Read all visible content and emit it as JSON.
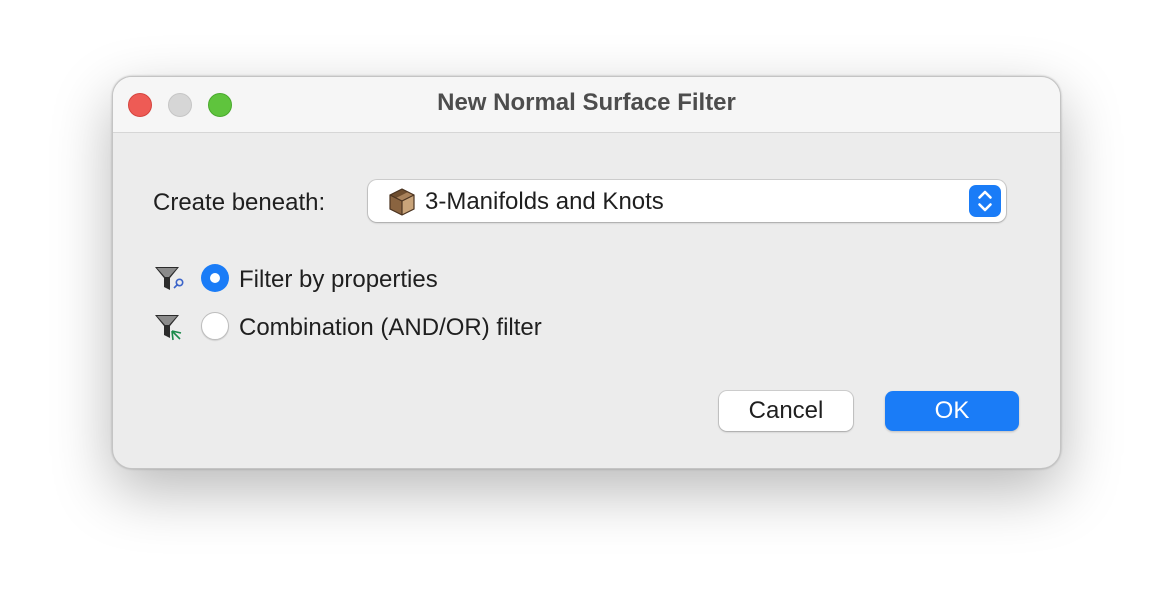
{
  "window": {
    "title": "New Normal Surface Filter"
  },
  "form": {
    "create_beneath_label": "Create beneath:",
    "create_beneath_value": "3-Manifolds and Knots",
    "create_beneath_icon": "box-package-icon"
  },
  "options": [
    {
      "label": "Filter by properties",
      "selected": true,
      "icon": "filter-properties-icon"
    },
    {
      "label": "Combination (AND/OR) filter",
      "selected": false,
      "icon": "filter-combination-icon"
    }
  ],
  "buttons": {
    "cancel_label": "Cancel",
    "ok_label": "OK"
  },
  "colors": {
    "accent": "#1a7cf7",
    "close": "#ee5b55",
    "minimize": "#d6d6d6",
    "maximize": "#5fc43d",
    "window_bg": "#ececec"
  }
}
